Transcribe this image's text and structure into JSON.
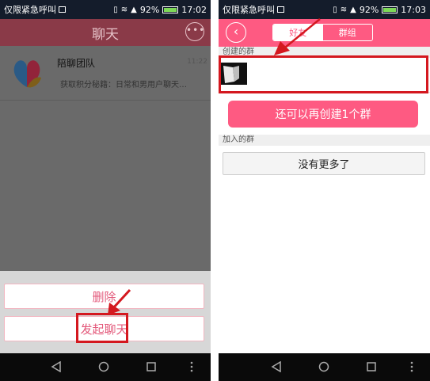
{
  "left": {
    "status_bar": {
      "carrier": "仅限紧急呼叫",
      "battery": "92%",
      "time": "17:02"
    },
    "header": {
      "title": "聊天",
      "more_icon": "ellipsis-circle-icon"
    },
    "chat_list": [
      {
        "name": "陪聊团队",
        "time": "11:22",
        "preview": "获取积分秘籍：日常和男用户聊天…"
      }
    ],
    "action_sheet": {
      "delete_label": "删除",
      "start_chat_label": "发起聊天"
    }
  },
  "right": {
    "status_bar": {
      "carrier": "仅限紧急呼叫",
      "battery": "92%",
      "time": "17:03"
    },
    "header": {
      "back_icon": "chevron-left-circle-icon",
      "tab_friends": "好友",
      "tab_groups": "群组",
      "active_tab": "群组"
    },
    "created_section": {
      "label": "创建的群"
    },
    "create_button": "还可以再创建1个群",
    "joined_section": {
      "label": "加入的群"
    },
    "no_more_label": "没有更多了"
  },
  "colors": {
    "brand_pink": "#fe5a82",
    "highlight_red": "#d4181f",
    "dim_header": "#8a3a48"
  },
  "annotations": {
    "highlight_color": "#d4181f",
    "arrow_color": "#d4181f"
  }
}
